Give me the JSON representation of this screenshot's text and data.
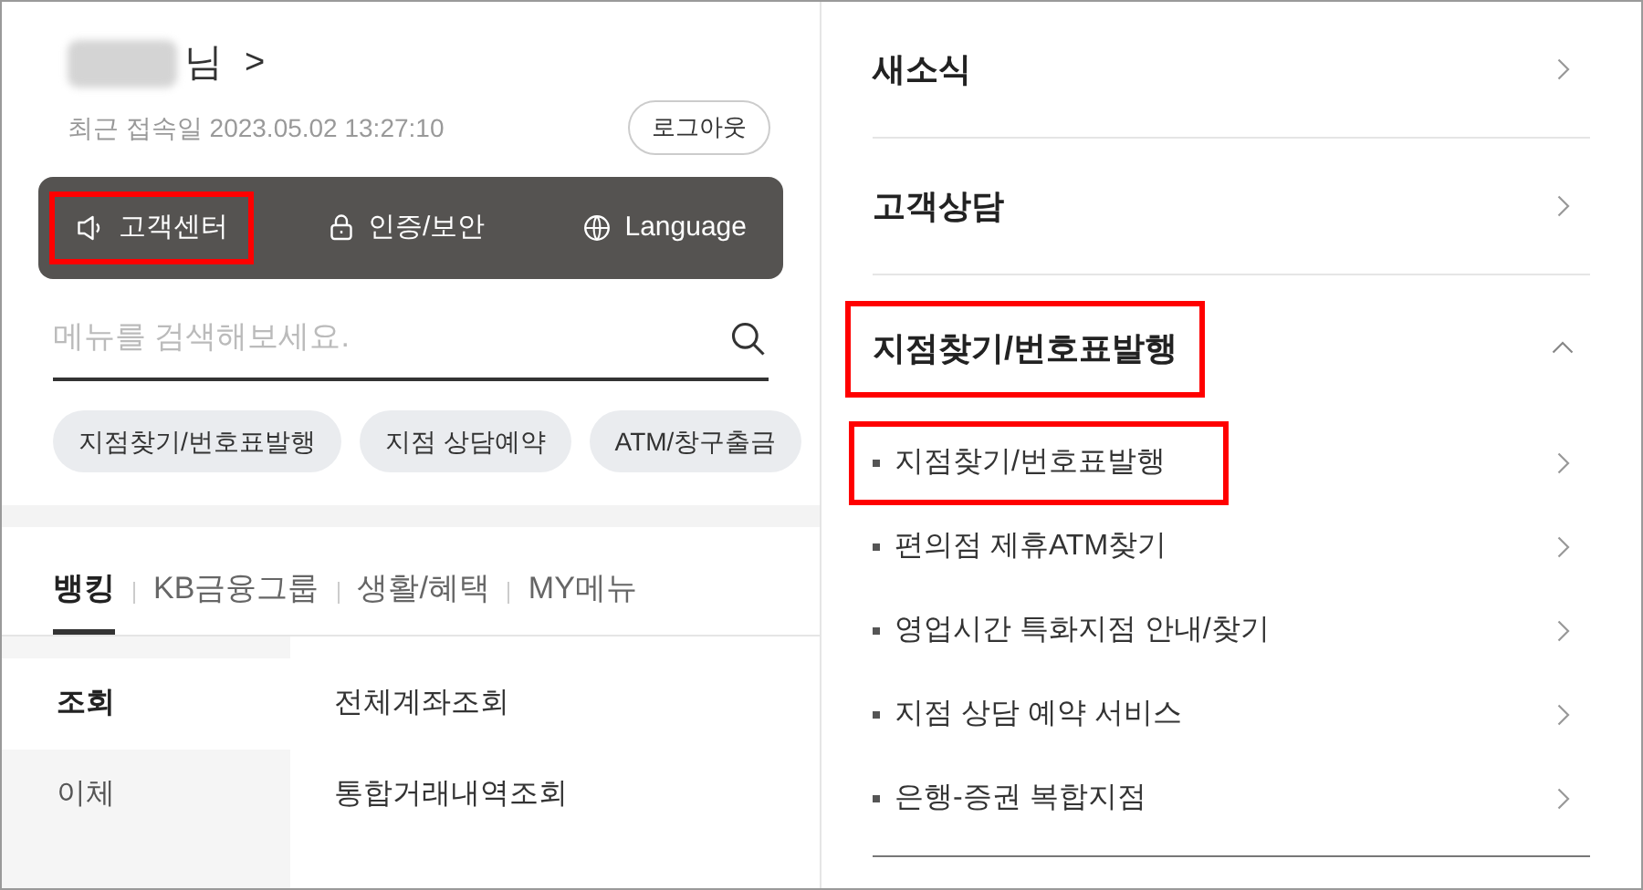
{
  "user": {
    "suffix": "님",
    "chevron": ">",
    "last_login": "최근 접속일 2023.05.02 13:27:10",
    "logout": "로그아웃"
  },
  "quick_buttons": [
    {
      "kind": "speaker",
      "label": "고객센터",
      "highlighted": true
    },
    {
      "kind": "lock",
      "label": "인증/보안",
      "highlighted": false
    },
    {
      "kind": "globe",
      "label": "Language",
      "highlighted": false
    }
  ],
  "search": {
    "placeholder": "메뉴를 검색해보세요."
  },
  "chips": [
    "지점찾기/번호표발행",
    "지점 상담예약",
    "ATM/창구출금"
  ],
  "tabs": [
    {
      "label": "뱅킹",
      "selected": true
    },
    {
      "label": "KB금융그룹",
      "selected": false
    },
    {
      "label": "생활/혜택",
      "selected": false
    },
    {
      "label": "MY메뉴",
      "selected": false
    }
  ],
  "categories": [
    {
      "label": "조회",
      "selected": true
    },
    {
      "label": "이체",
      "selected": false
    }
  ],
  "menu_items": [
    "전체계좌조회",
    "통합거래내역조회"
  ],
  "sections": [
    {
      "label": "새소식",
      "expanded": false,
      "highlighted": false
    },
    {
      "label": "고객상담",
      "expanded": false,
      "highlighted": false
    },
    {
      "label": "지점찾기/번호표발행",
      "expanded": true,
      "highlighted": true,
      "children": [
        {
          "label": "지점찾기/번호표발행",
          "highlighted": true
        },
        {
          "label": "편의점 제휴ATM찾기",
          "highlighted": false
        },
        {
          "label": "영업시간 특화지점 안내/찾기",
          "highlighted": false
        },
        {
          "label": "지점 상담 예약 서비스",
          "highlighted": false
        },
        {
          "label": "은행-증권 복합지점",
          "highlighted": false
        }
      ]
    }
  ]
}
